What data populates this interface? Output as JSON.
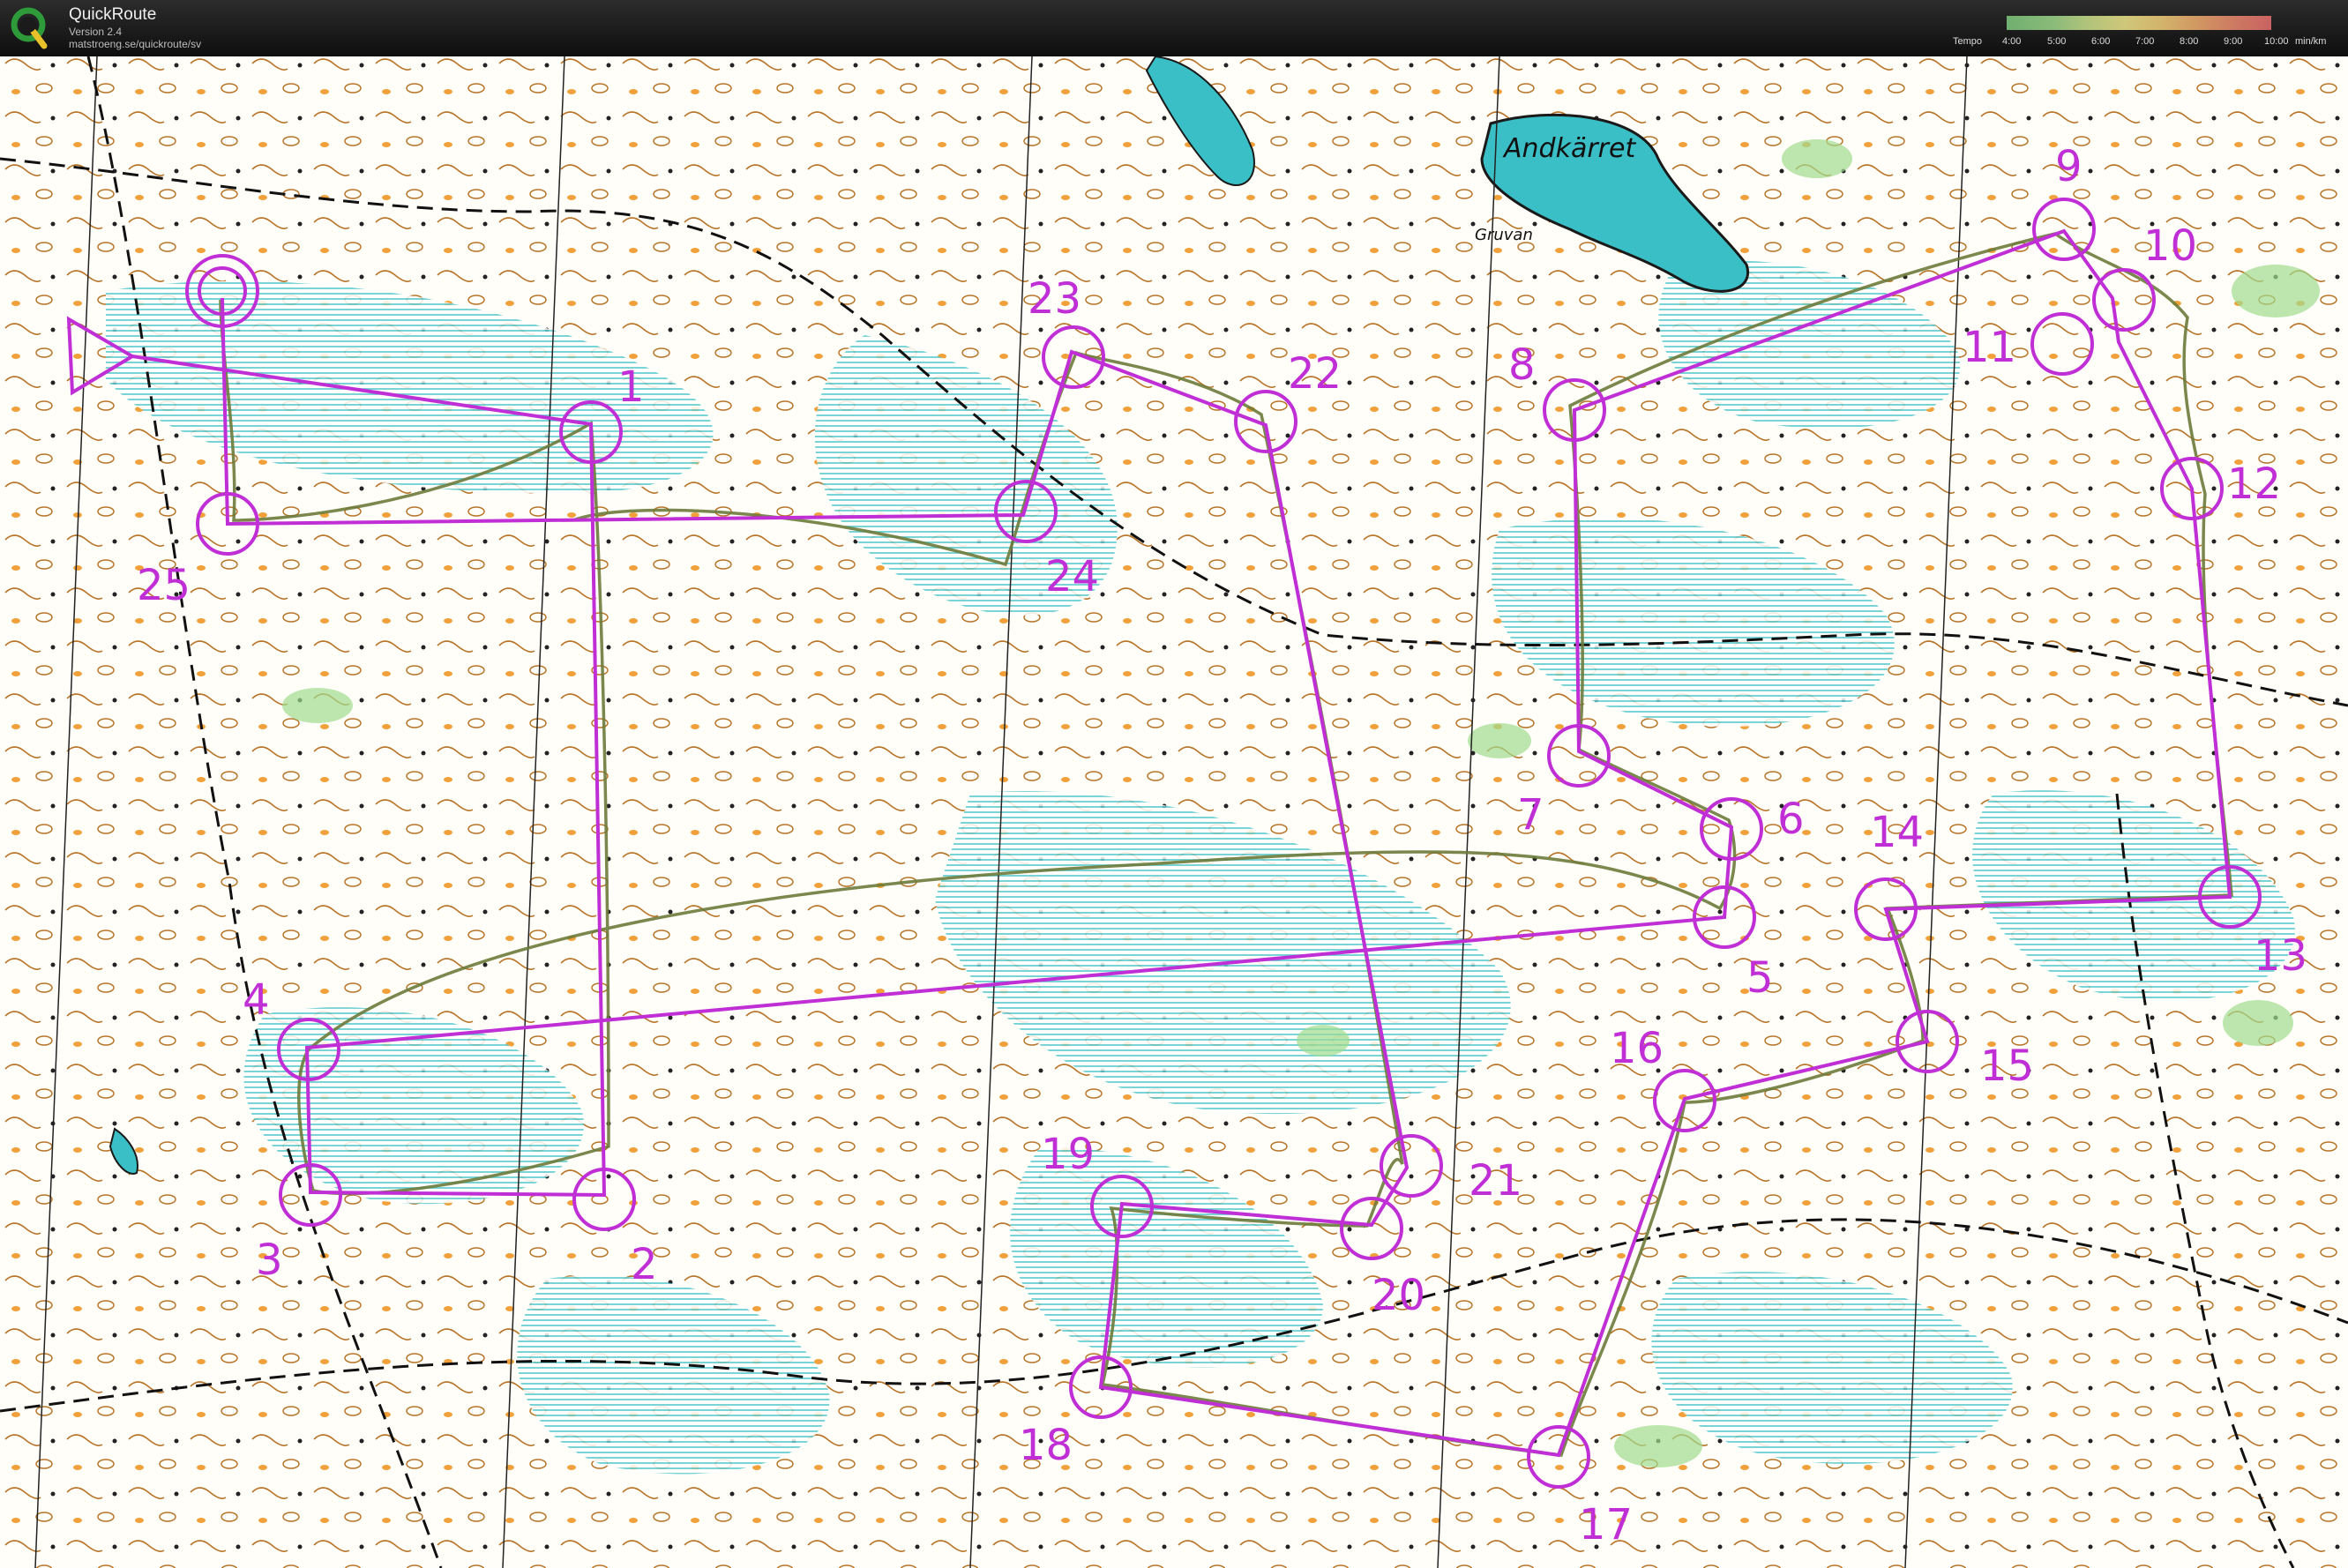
{
  "app": {
    "title": "QuickRoute",
    "version": "Version 2.4",
    "url": "matstroeng.se/quickroute/sv",
    "logo_icon": "quickroute-logo-icon"
  },
  "tempo_legend": {
    "label": "Tempo",
    "ticks": [
      "4:00",
      "5:00",
      "6:00",
      "7:00",
      "8:00",
      "9:00",
      "10:00"
    ],
    "unit": "min/km",
    "colors": [
      "#7ec97e",
      "#c9e08a",
      "#efe58a",
      "#f0ad6e",
      "#e86e6e"
    ]
  },
  "map": {
    "lake_name": "Andkärret",
    "place_name": "Gruvan",
    "course_color": "#c02fd6",
    "route_color": "#6b7a3a",
    "controls": [
      "1",
      "2",
      "3",
      "4",
      "5",
      "6",
      "7",
      "8",
      "9",
      "10",
      "11",
      "12",
      "13",
      "14",
      "15",
      "16",
      "17",
      "18",
      "19",
      "20",
      "21",
      "22",
      "23",
      "24",
      "25"
    ],
    "start_icon": "start-triangle-icon",
    "finish_icon": "finish-double-circle-icon"
  }
}
